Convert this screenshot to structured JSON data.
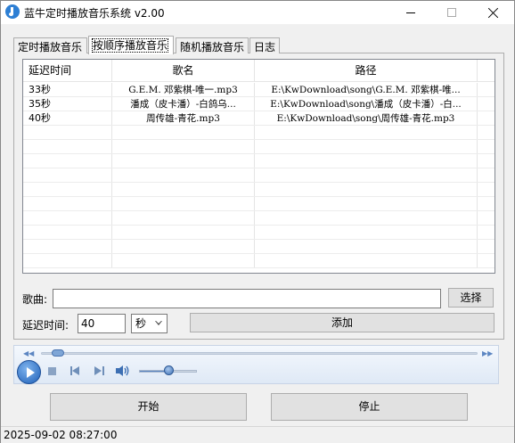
{
  "window": {
    "title": "蓝牛定时播放音乐系统  v2.00"
  },
  "tabs": [
    {
      "label": "定时播放音乐"
    },
    {
      "label": "按顺序播放音乐"
    },
    {
      "label": "随机播放音乐"
    },
    {
      "label": "日志"
    }
  ],
  "active_tab": "按顺序播放音乐",
  "table": {
    "headers": [
      "延迟时间",
      "歌名",
      "路径"
    ],
    "rows": [
      {
        "delay": "33秒",
        "song": "G.E.M. 邓紫棋-唯一.mp3",
        "path": "E:\\KwDownload\\song\\G.E.M. 邓紫棋-唯..."
      },
      {
        "delay": "35秒",
        "song": "潘成（皮卡潘）-白鸽乌...",
        "path": "E:\\KwDownload\\song\\潘成（皮卡潘）-白..."
      },
      {
        "delay": "40秒",
        "song": "周传雄-青花.mp3",
        "path": "E:\\KwDownload\\song\\周传雄-青花.mp3"
      }
    ]
  },
  "form": {
    "song_label": "歌曲:",
    "song_value": "",
    "browse_label": "选择",
    "delay_label": "延迟时间:",
    "delay_value": "40",
    "unit_value": "秒",
    "add_label": "添加"
  },
  "player": {
    "seek_progress": 0.03,
    "volume": 0.5
  },
  "buttons": {
    "start": "开始",
    "stop": "停止"
  },
  "status": {
    "timestamp": "2025-09-02 08:27:00"
  },
  "icons": {
    "app": "music-note-icon",
    "play": "play-icon",
    "stop": "stop-icon",
    "prev": "previous-track-icon",
    "next": "next-track-icon",
    "volume": "speaker-icon"
  },
  "colors": {
    "accent": "#1e5fb7",
    "player_bg": "#dfe9f6"
  }
}
